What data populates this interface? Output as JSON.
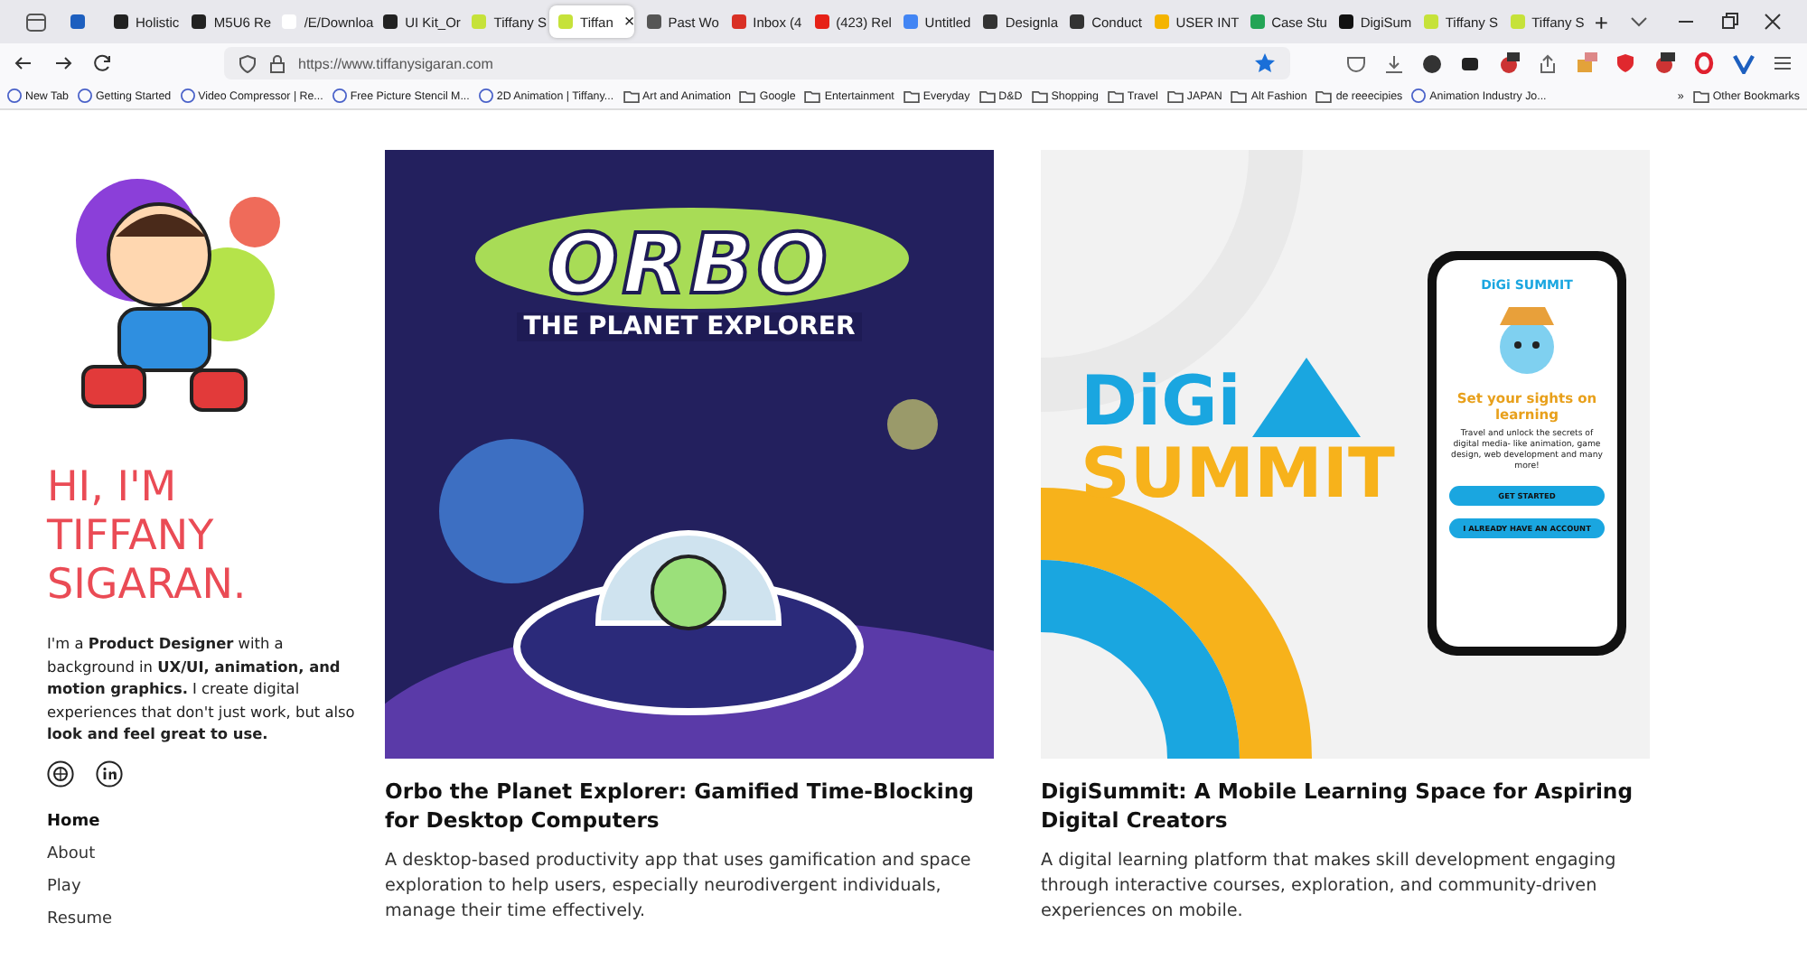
{
  "browser": {
    "tabs": [
      {
        "color": "#1d5fbf",
        "selected": false
      },
      {
        "title": "Holistic",
        "color": "#222222",
        "selected": false
      },
      {
        "title": "M5U6 Re",
        "color": "#222222",
        "selected": false
      },
      {
        "title": "/E/Downloa",
        "color": "#ffffff",
        "selected": false
      },
      {
        "title": "UI Kit_Or",
        "color": "#222222",
        "selected": false
      },
      {
        "title": "Tiffany S",
        "color": "#c6e23a",
        "selected": false
      },
      {
        "title": "Tiffan",
        "color": "#c6e23a",
        "selected": true
      },
      {
        "title": "Past Wo",
        "color": "#555555",
        "selected": false
      },
      {
        "title": "Inbox (4",
        "color": "#d93025",
        "selected": false
      },
      {
        "title": "(423) Rel",
        "color": "#e62117",
        "selected": false
      },
      {
        "title": "Untitled",
        "color": "#4285f4",
        "selected": false
      },
      {
        "title": "Designla",
        "color": "#333333",
        "selected": false
      },
      {
        "title": "Conduct",
        "color": "#333333",
        "selected": false
      },
      {
        "title": "USER INT",
        "color": "#f4b400",
        "selected": false
      },
      {
        "title": "Case Stu",
        "color": "#23a455",
        "selected": false
      },
      {
        "title": "DigiSum",
        "color": "#111111",
        "selected": false
      },
      {
        "title": "Tiffany S",
        "color": "#c6e23a",
        "selected": false
      },
      {
        "title": "Tiffany S",
        "color": "#c6e23a",
        "selected": false
      }
    ],
    "close_glyph": "×",
    "new_tab_glyph": "+",
    "url": "https://www.tiffanysigaran.com",
    "bookmarks": [
      {
        "kind": "link",
        "label": "New Tab"
      },
      {
        "kind": "link",
        "label": "Getting Started"
      },
      {
        "kind": "link",
        "label": "Video Compressor | Re..."
      },
      {
        "kind": "link",
        "label": "Free Picture Stencil M..."
      },
      {
        "kind": "link",
        "label": "2D Animation | Tiffany..."
      },
      {
        "kind": "folder",
        "label": "Art and Animation"
      },
      {
        "kind": "folder",
        "label": "Google"
      },
      {
        "kind": "folder",
        "label": "Entertainment"
      },
      {
        "kind": "folder",
        "label": "Everyday"
      },
      {
        "kind": "folder",
        "label": "D&D"
      },
      {
        "kind": "folder",
        "label": "Shopping"
      },
      {
        "kind": "folder",
        "label": "Travel"
      },
      {
        "kind": "folder",
        "label": "JAPAN"
      },
      {
        "kind": "folder",
        "label": "Alt Fashion"
      },
      {
        "kind": "folder",
        "label": "de reeecipies"
      },
      {
        "kind": "link",
        "label": "Animation Industry Jo..."
      }
    ],
    "overflow_glyph": "»",
    "other_bookmarks": "Other Bookmarks"
  },
  "sidebar": {
    "heading": [
      "HI, I'M",
      "TIFFANY",
      "SIGARAN."
    ],
    "bio": "I'm a **Product Designer** with a background in **UX/UI, animation, and motion graphics.** I create digital experiences that don't just work, but also **look and feel great to use.**",
    "nav": [
      {
        "label": "Home",
        "selected": true
      },
      {
        "label": "About",
        "selected": false
      },
      {
        "label": "Play",
        "selected": false
      },
      {
        "label": "Resume",
        "selected": false
      }
    ]
  },
  "projects": [
    {
      "kind": "orbo",
      "art_title": "ORBO",
      "art_subtitle": "THE PLANET EXPLORER",
      "title": "Orbo the Planet Explorer: Gamified Time-Blocking for Desktop Computers",
      "description": "A desktop-based productivity app that uses gamification and space exploration to help users, especially neurodivergent individuals, manage their time effectively."
    },
    {
      "kind": "digi",
      "art_title": "DiGi",
      "art_subtitle": "SUMMIT",
      "phone": {
        "logo": "DiGi SUMMIT",
        "headline": "Set your sights on learning",
        "text": "Travel and unlock the secrets of digital media- like animation, game design, web development and many more!",
        "buttons": [
          "GET STARTED",
          "I ALREADY HAVE AN ACCOUNT"
        ]
      },
      "title": "DigiSummit: A Mobile Learning Space for Aspiring Digital Creators",
      "description": "A digital learning platform that makes skill development engaging through interactive courses, exploration, and community-driven experiences on mobile."
    }
  ]
}
